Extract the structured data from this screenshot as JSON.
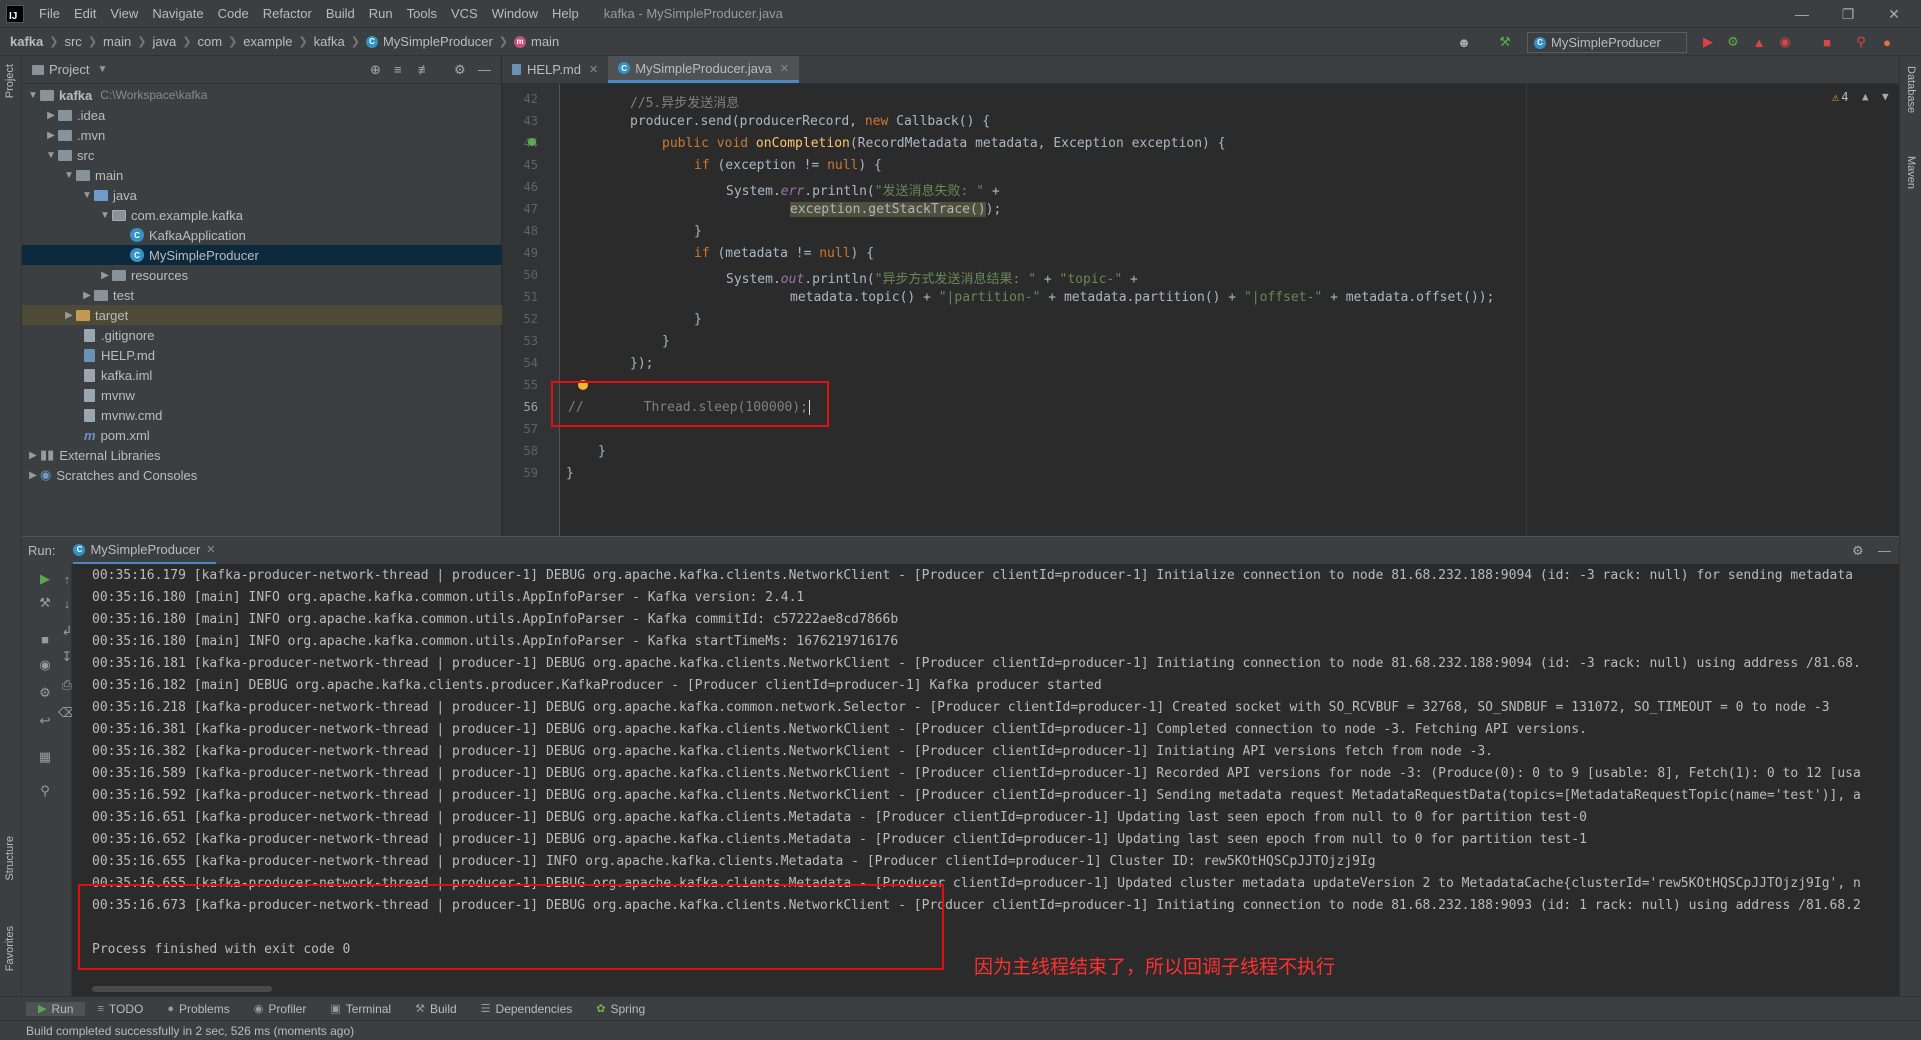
{
  "menubar": {
    "logo": "IJ",
    "items": [
      "File",
      "Edit",
      "View",
      "Navigate",
      "Code",
      "Refactor",
      "Build",
      "Run",
      "Tools",
      "VCS",
      "Window",
      "Help"
    ],
    "window_title": "kafka - MySimpleProducer.java"
  },
  "navbar": {
    "crumbs": [
      "kafka",
      "src",
      "main",
      "java",
      "com",
      "example",
      "kafka",
      "MySimpleProducer",
      "main"
    ],
    "run_config": "MySimpleProducer"
  },
  "left_strip": {
    "project": "Project",
    "structure": "Structure",
    "favorites": "Favorites"
  },
  "right_strip": {
    "database": "Database",
    "maven": "Maven"
  },
  "project_panel": {
    "title": "Project",
    "root_path": "C:\\Workspace\\kafka",
    "tree": [
      {
        "label": "kafka"
      },
      {
        "label": ".idea"
      },
      {
        "label": ".mvn"
      },
      {
        "label": "src"
      },
      {
        "label": "main"
      },
      {
        "label": "java"
      },
      {
        "label": "com.example.kafka"
      },
      {
        "label": "KafkaApplication"
      },
      {
        "label": "MySimpleProducer"
      },
      {
        "label": "resources"
      },
      {
        "label": "test"
      },
      {
        "label": "target"
      },
      {
        "label": ".gitignore"
      },
      {
        "label": "HELP.md"
      },
      {
        "label": "kafka.iml"
      },
      {
        "label": "mvnw"
      },
      {
        "label": "mvnw.cmd"
      },
      {
        "label": "pom.xml"
      },
      {
        "label": "External Libraries"
      },
      {
        "label": "Scratches and Consoles"
      }
    ]
  },
  "editor": {
    "tabs": [
      "HELP.md",
      "MySimpleProducer.java"
    ],
    "warnings": "4",
    "line_numbers": [
      "42",
      "43",
      "44",
      "45",
      "46",
      "47",
      "48",
      "49",
      "50",
      "51",
      "52",
      "53",
      "54",
      "55",
      "56",
      "57",
      "58",
      "59"
    ],
    "lines": {
      "l42": "//5.异步发送消息",
      "l43a": "producer.send(producerRecord, ",
      "l43b": "new",
      "l43c": " Callback() {",
      "l44a": "public void ",
      "l44b": "onCompletion",
      "l44c": "(RecordMetadata metadata, Exception exception) {",
      "l45a": "if",
      "l45b": " (exception != ",
      "l45c": "null",
      "l45d": ") {",
      "l46a": "System.",
      "l46b": "err",
      "l46c": ".println(",
      "l46d": "\"发送消息失败: \"",
      "l46e": " +",
      "l47a": "exception.getStackTrace()",
      "l47b": ");",
      "l48": "}",
      "l49a": "if",
      "l49b": " (metadata != ",
      "l49c": "null",
      "l49d": ") {",
      "l50a": "System.",
      "l50b": "out",
      "l50c": ".println(",
      "l50d": "\"异步方式发送消息结果: \"",
      "l50e": " + ",
      "l50f": "\"topic-\"",
      "l50g": " +",
      "l51a": "metadata.topic() + ",
      "l51b": "\"|partition-\"",
      "l51c": " + metadata.partition() + ",
      "l51d": "\"|offset-\"",
      "l51e": " + metadata.offset());",
      "l52": "}",
      "l53": "}",
      "l54": "});",
      "l56a": "//",
      "l56b": "Thread.sleep(100000);",
      "l58": "}",
      "l59": "}"
    }
  },
  "run_panel": {
    "label": "Run:",
    "tab": "MySimpleProducer",
    "console_lines": [
      "00:35:16.179 [kafka-producer-network-thread | producer-1] DEBUG org.apache.kafka.clients.NetworkClient - [Producer clientId=producer-1] Initialize connection to node 81.68.232.188:9094 (id: -3 rack: null) for sending metadata",
      "00:35:16.180 [main] INFO org.apache.kafka.common.utils.AppInfoParser - Kafka version: 2.4.1",
      "00:35:16.180 [main] INFO org.apache.kafka.common.utils.AppInfoParser - Kafka commitId: c57222ae8cd7866b",
      "00:35:16.180 [main] INFO org.apache.kafka.common.utils.AppInfoParser - Kafka startTimeMs: 1676219716176",
      "00:35:16.181 [kafka-producer-network-thread | producer-1] DEBUG org.apache.kafka.clients.NetworkClient - [Producer clientId=producer-1] Initiating connection to node 81.68.232.188:9094 (id: -3 rack: null) using address /81.68.",
      "00:35:16.182 [main] DEBUG org.apache.kafka.clients.producer.KafkaProducer - [Producer clientId=producer-1] Kafka producer started",
      "00:35:16.218 [kafka-producer-network-thread | producer-1] DEBUG org.apache.kafka.common.network.Selector - [Producer clientId=producer-1] Created socket with SO_RCVBUF = 32768, SO_SNDBUF = 131072, SO_TIMEOUT = 0 to node -3",
      "00:35:16.381 [kafka-producer-network-thread | producer-1] DEBUG org.apache.kafka.clients.NetworkClient - [Producer clientId=producer-1] Completed connection to node -3. Fetching API versions.",
      "00:35:16.382 [kafka-producer-network-thread | producer-1] DEBUG org.apache.kafka.clients.NetworkClient - [Producer clientId=producer-1] Initiating API versions fetch from node -3.",
      "00:35:16.589 [kafka-producer-network-thread | producer-1] DEBUG org.apache.kafka.clients.NetworkClient - [Producer clientId=producer-1] Recorded API versions for node -3: (Produce(0): 0 to 9 [usable: 8], Fetch(1): 0 to 12 [usa",
      "00:35:16.592 [kafka-producer-network-thread | producer-1] DEBUG org.apache.kafka.clients.NetworkClient - [Producer clientId=producer-1] Sending metadata request MetadataRequestData(topics=[MetadataRequestTopic(name='test')], a",
      "00:35:16.651 [kafka-producer-network-thread | producer-1] DEBUG org.apache.kafka.clients.Metadata - [Producer clientId=producer-1] Updating last seen epoch from null to 0 for partition test-0",
      "00:35:16.652 [kafka-producer-network-thread | producer-1] DEBUG org.apache.kafka.clients.Metadata - [Producer clientId=producer-1] Updating last seen epoch from null to 0 for partition test-1",
      "00:35:16.655 [kafka-producer-network-thread | producer-1] INFO org.apache.kafka.clients.Metadata - [Producer clientId=producer-1] Cluster ID: rew5KOtHQSCpJJTOjzj9Ig",
      "00:35:16.655 [kafka-producer-network-thread | producer-1] DEBUG org.apache.kafka.clients.Metadata - [Producer clientId=producer-1] Updated cluster metadata updateVersion 2 to MetadataCache{clusterId='rew5KOtHQSCpJJTOjzj9Ig', n",
      "00:35:16.673 [kafka-producer-network-thread | producer-1] DEBUG org.apache.kafka.clients.NetworkClient - [Producer clientId=producer-1] Initiating connection to node 81.68.232.188:9093 (id: 1 rack: null) using address /81.68.2",
      "",
      "Process finished with exit code 0"
    ],
    "annotation": "因为主线程结束了，所以回调子线程不执行"
  },
  "bottom_tabs": [
    "Run",
    "TODO",
    "Problems",
    "Profiler",
    "Terminal",
    "Build",
    "Dependencies",
    "Spring"
  ],
  "status": "Build completed successfully in 2 sec, 526 ms (moments ago)"
}
